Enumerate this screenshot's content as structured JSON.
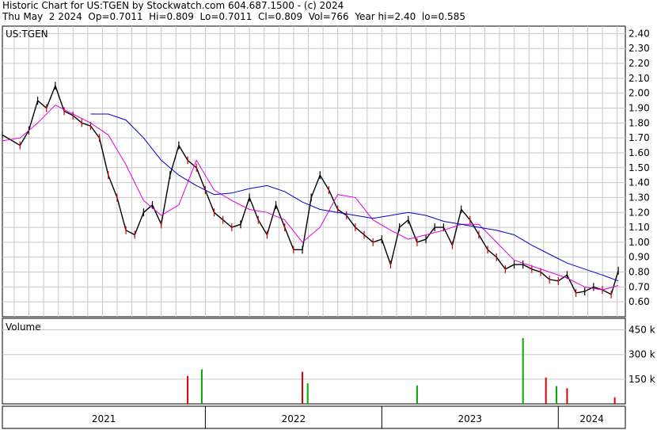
{
  "header": {
    "line1": "Historic Chart for US:TGEN by Stockwatch.com 604.687.1500 - (c) 2024",
    "line2": "Thu May  2 2024  Op=0.7011  Hi=0.809  Lo=0.7011  Cl=0.809  Vol=766  Year hi=2.40  lo=0.585"
  },
  "colors": {
    "price": "#000000",
    "down_tick": "#cc0000",
    "ma_short": "#e000e0",
    "ma_long": "#0000cc",
    "vol_up": "#00aa00",
    "vol_down": "#dd0000",
    "grid": "#c8c8c8"
  },
  "chart_data": [
    {
      "type": "line",
      "title": "US:TGEN",
      "x_ticks": [
        "2021",
        "2022",
        "2023",
        "2024"
      ],
      "y_ticks": [
        "2.40",
        "2.30",
        "2.20",
        "2.10",
        "2.00",
        "1.90",
        "1.80",
        "1.70",
        "1.60",
        "1.50",
        "1.40",
        "1.30",
        "1.20",
        "1.10",
        "1.00",
        "0.90",
        "0.80",
        "0.70",
        "0.60"
      ],
      "ylim": [
        0.5,
        2.45
      ],
      "xlim": [
        2020.85,
        2024.38
      ],
      "grid": true,
      "series": [
        {
          "key": "price",
          "x": [
            2020.85,
            2020.95,
            2021.0,
            2021.05,
            2021.1,
            2021.15,
            2021.2,
            2021.25,
            2021.3,
            2021.35,
            2021.4,
            2021.45,
            2021.5,
            2021.55,
            2021.6,
            2021.65,
            2021.7,
            2021.75,
            2021.8,
            2021.85,
            2021.9,
            2021.95,
            2022.0,
            2022.05,
            2022.1,
            2022.15,
            2022.2,
            2022.25,
            2022.3,
            2022.35,
            2022.4,
            2022.45,
            2022.5,
            2022.55,
            2022.6,
            2022.65,
            2022.7,
            2022.75,
            2022.8,
            2022.85,
            2022.9,
            2022.95,
            2023.0,
            2023.05,
            2023.1,
            2023.15,
            2023.2,
            2023.25,
            2023.3,
            2023.35,
            2023.4,
            2023.45,
            2023.5,
            2023.55,
            2023.6,
            2023.65,
            2023.7,
            2023.75,
            2023.8,
            2023.85,
            2023.9,
            2023.95,
            2024.0,
            2024.05,
            2024.1,
            2024.15,
            2024.2,
            2024.25,
            2024.3,
            2024.34
          ],
          "y": [
            1.72,
            1.65,
            1.75,
            1.95,
            1.9,
            2.05,
            1.88,
            1.85,
            1.8,
            1.78,
            1.7,
            1.45,
            1.3,
            1.08,
            1.05,
            1.2,
            1.25,
            1.12,
            1.45,
            1.65,
            1.55,
            1.5,
            1.35,
            1.2,
            1.15,
            1.1,
            1.12,
            1.3,
            1.15,
            1.05,
            1.25,
            1.1,
            0.95,
            0.95,
            1.3,
            1.45,
            1.35,
            1.22,
            1.18,
            1.1,
            1.05,
            1.0,
            1.02,
            0.85,
            1.1,
            1.15,
            1.0,
            1.02,
            1.1,
            1.1,
            0.98,
            1.22,
            1.15,
            1.05,
            0.95,
            0.9,
            0.82,
            0.85,
            0.85,
            0.82,
            0.8,
            0.75,
            0.74,
            0.78,
            0.66,
            0.67,
            0.7,
            0.68,
            0.65,
            0.809
          ]
        },
        {
          "key": "ma_short",
          "x": [
            2020.85,
            2020.95,
            2021.05,
            2021.15,
            2021.25,
            2021.35,
            2021.45,
            2021.55,
            2021.65,
            2021.75,
            2021.85,
            2021.95,
            2022.05,
            2022.15,
            2022.25,
            2022.35,
            2022.45,
            2022.55,
            2022.65,
            2022.75,
            2022.85,
            2022.95,
            2023.05,
            2023.15,
            2023.25,
            2023.35,
            2023.45,
            2023.55,
            2023.65,
            2023.75,
            2023.85,
            2023.95,
            2024.05,
            2024.15,
            2024.25,
            2024.34
          ],
          "y": [
            1.68,
            1.7,
            1.8,
            1.92,
            1.86,
            1.8,
            1.72,
            1.52,
            1.28,
            1.18,
            1.25,
            1.55,
            1.35,
            1.28,
            1.22,
            1.2,
            1.15,
            1.0,
            1.1,
            1.32,
            1.3,
            1.15,
            1.08,
            1.02,
            1.05,
            1.08,
            1.12,
            1.12,
            1.0,
            0.88,
            0.84,
            0.8,
            0.76,
            0.7,
            0.68,
            0.71
          ]
        },
        {
          "key": "ma_long",
          "x": [
            2021.35,
            2021.45,
            2021.55,
            2021.65,
            2021.75,
            2021.85,
            2021.95,
            2022.05,
            2022.15,
            2022.25,
            2022.35,
            2022.45,
            2022.55,
            2022.65,
            2022.75,
            2022.85,
            2022.95,
            2023.05,
            2023.15,
            2023.25,
            2023.35,
            2023.45,
            2023.55,
            2023.65,
            2023.75,
            2023.85,
            2023.95,
            2024.05,
            2024.15,
            2024.25,
            2024.34
          ],
          "y": [
            1.86,
            1.86,
            1.82,
            1.7,
            1.55,
            1.45,
            1.38,
            1.32,
            1.33,
            1.36,
            1.38,
            1.34,
            1.27,
            1.22,
            1.2,
            1.18,
            1.16,
            1.18,
            1.2,
            1.18,
            1.14,
            1.12,
            1.1,
            1.08,
            1.05,
            0.98,
            0.92,
            0.86,
            0.82,
            0.78,
            0.74
          ]
        }
      ]
    },
    {
      "type": "bar",
      "title": "Volume",
      "y_ticks": [
        "450 k",
        "300 k",
        "150 k"
      ],
      "ylim": [
        0,
        520
      ],
      "x": [
        2021.9,
        2021.98,
        2022.55,
        2022.58,
        2023.2,
        2023.8,
        2023.93,
        2023.99,
        2024.05,
        2024.32
      ],
      "values": [
        170,
        210,
        195,
        125,
        112,
        400,
        160,
        108,
        95,
        40
      ],
      "up": [
        false,
        true,
        false,
        true,
        true,
        true,
        false,
        true,
        false,
        false
      ]
    }
  ]
}
